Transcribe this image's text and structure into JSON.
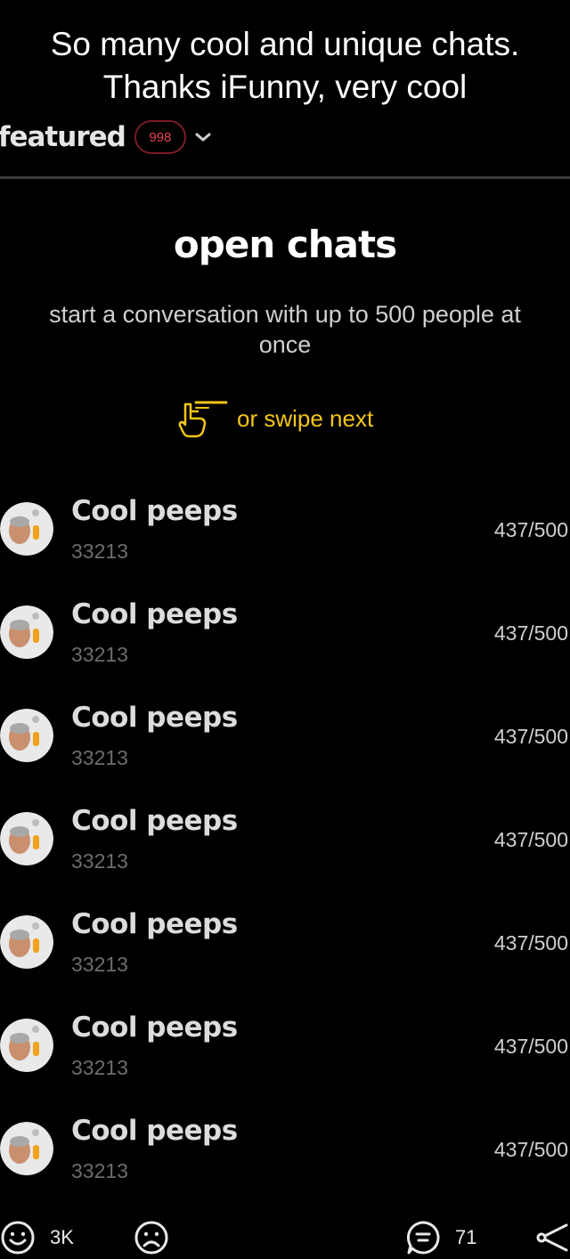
{
  "caption": {
    "line1": "So many cool and unique chats.",
    "line2": "Thanks iFunny, very cool"
  },
  "featured": {
    "label": "featured",
    "badge": "998",
    "chevron_icon": "chevron-down-icon"
  },
  "open_chats": {
    "title": "open chats",
    "subtitle": "start a conversation with up to 500 people at once",
    "swipe_icon": "swipe-hand-icon",
    "swipe_text": "or swipe next"
  },
  "chats": [
    {
      "name": "Cool peeps",
      "count": "33213",
      "members": "437/500"
    },
    {
      "name": "Cool peeps",
      "count": "33213",
      "members": "437/500"
    },
    {
      "name": "Cool peeps",
      "count": "33213",
      "members": "437/500"
    },
    {
      "name": "Cool peeps",
      "count": "33213",
      "members": "437/500"
    },
    {
      "name": "Cool peeps",
      "count": "33213",
      "members": "437/500"
    },
    {
      "name": "Cool peeps",
      "count": "33213",
      "members": "437/500"
    },
    {
      "name": "Cool peeps",
      "count": "33213",
      "members": "437/500"
    }
  ],
  "bottom_bar": {
    "smile_icon": "smile-icon",
    "smile_count": "3K",
    "unsmile_icon": "unsmile-icon",
    "comment_icon": "comment-icon",
    "comment_count": "71",
    "share_icon": "share-icon"
  },
  "colors": {
    "background": "#000000",
    "accent_yellow": "#f5c518",
    "badge_red": "#e8434f",
    "divider": "#3c3c3c"
  }
}
